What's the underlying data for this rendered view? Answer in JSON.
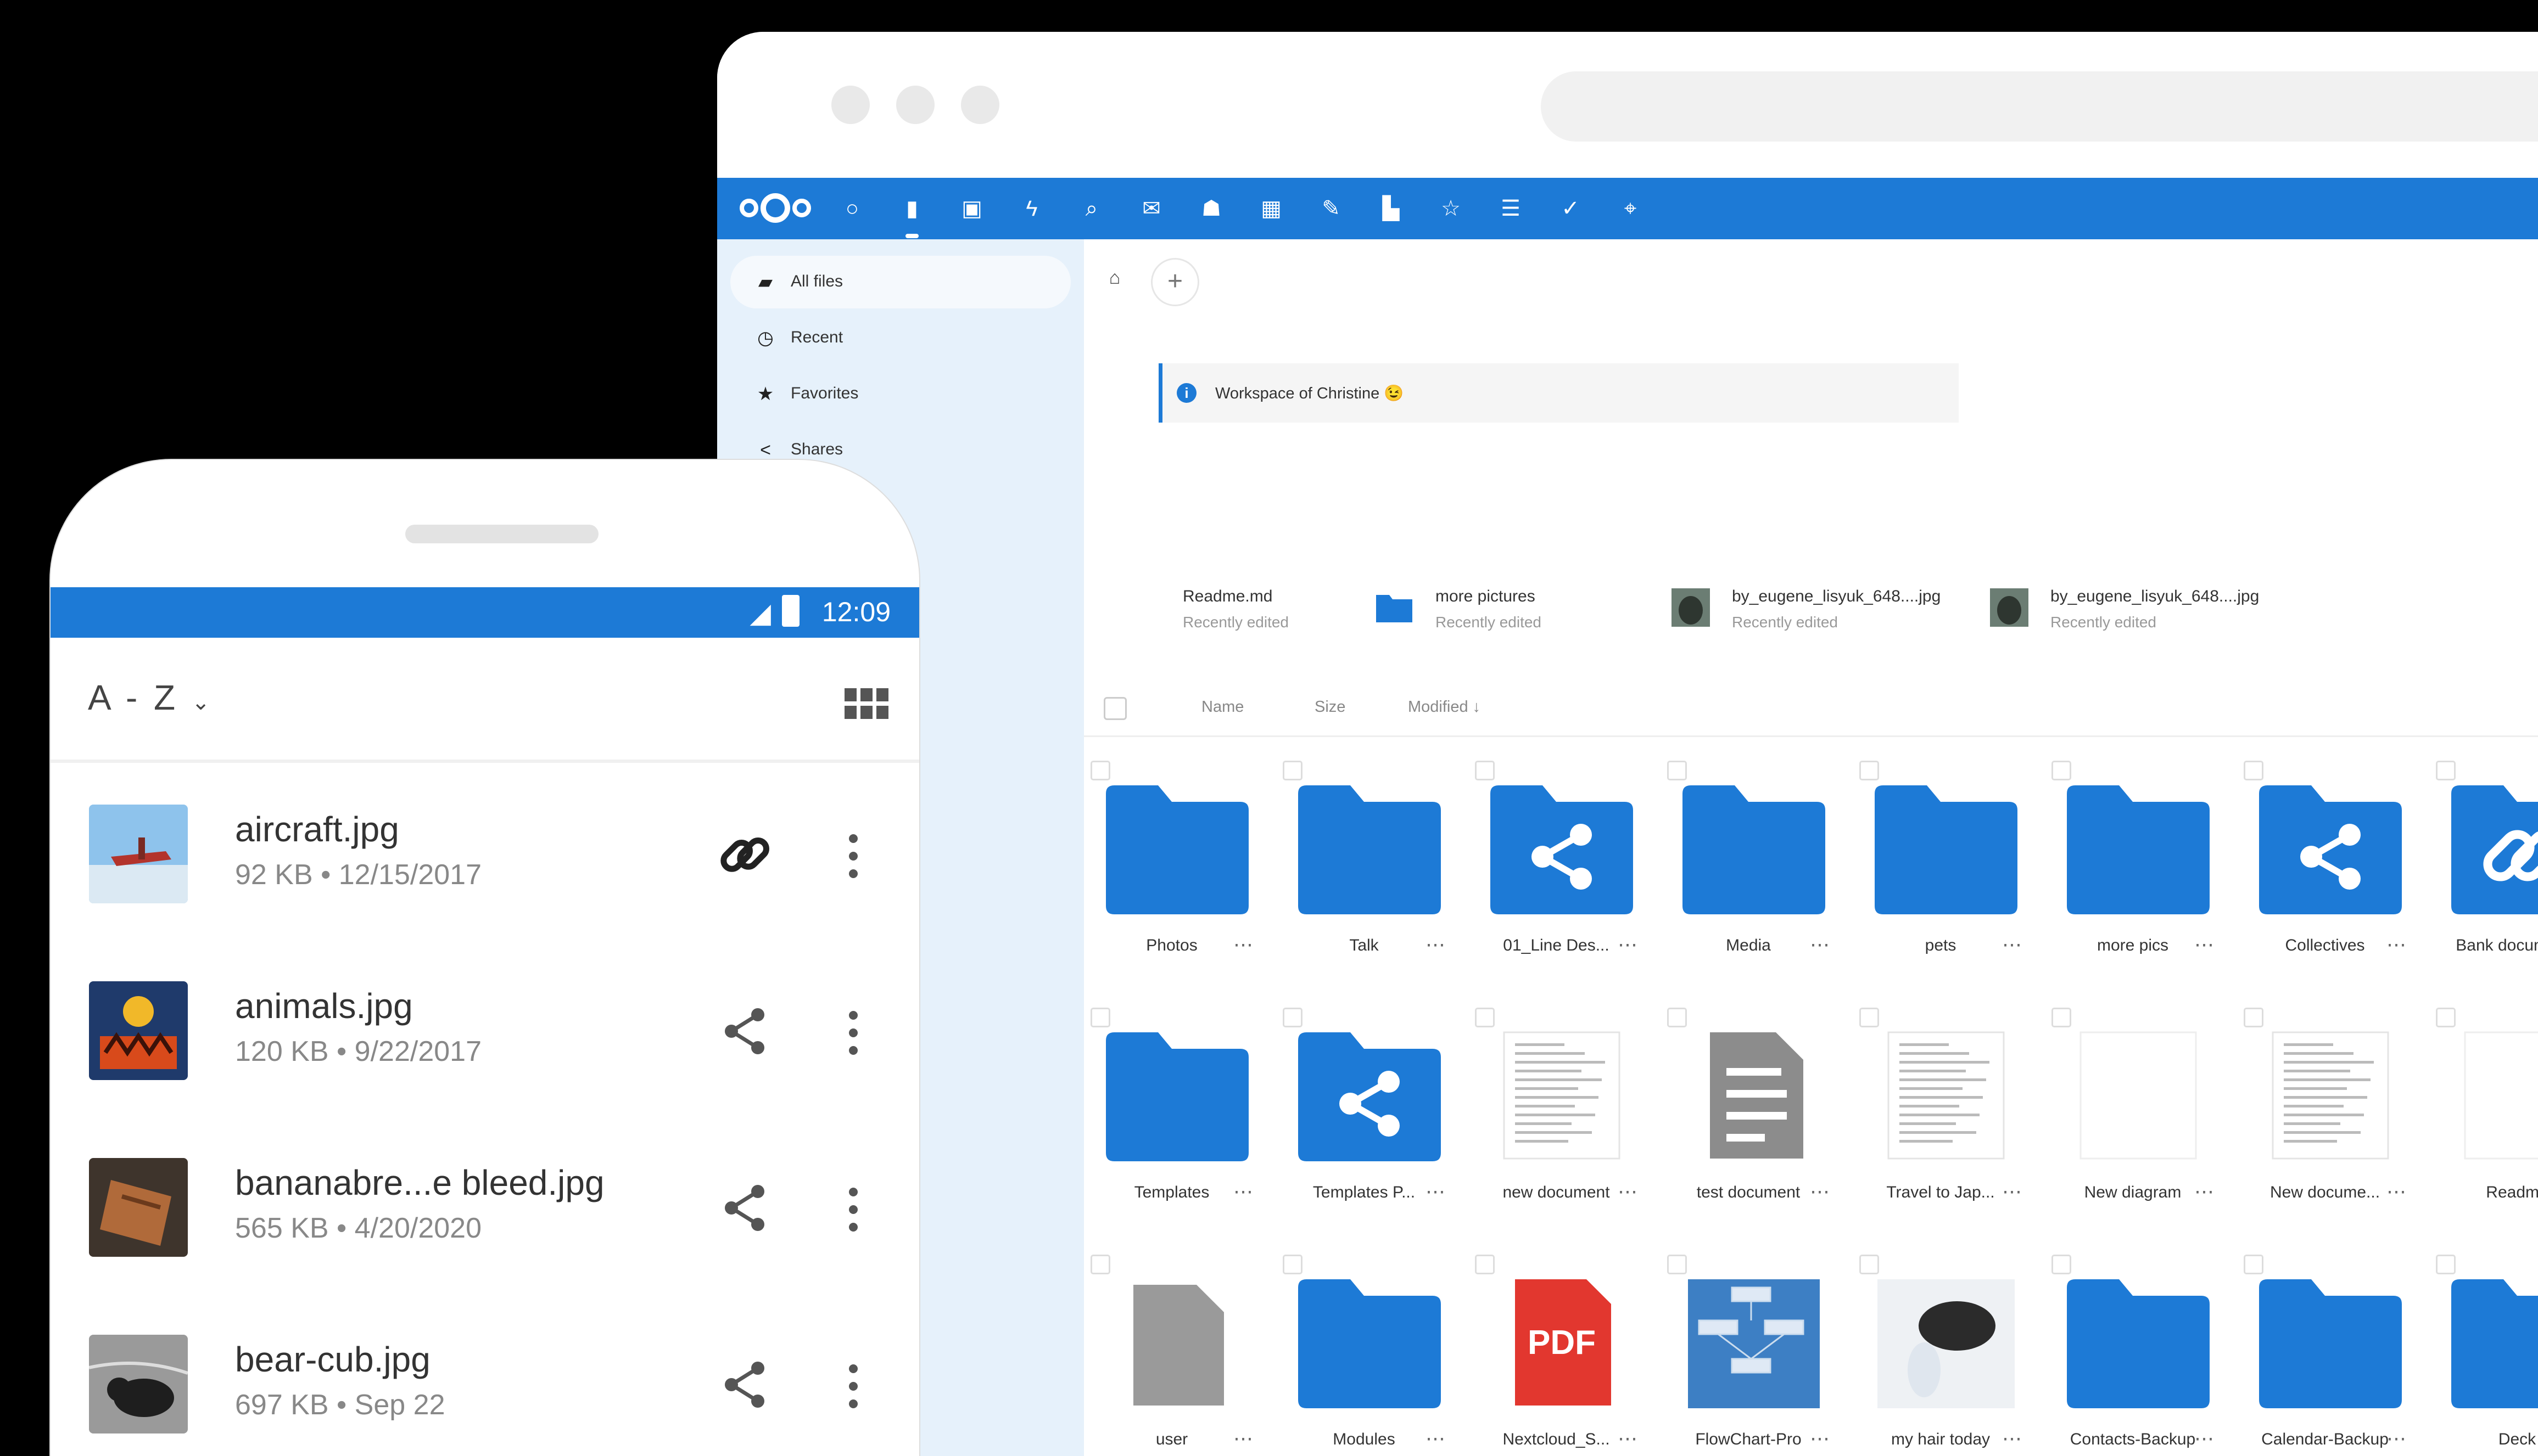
{
  "colors": {
    "brand": "#1d7ad6",
    "folder": "#1d7ad6",
    "sidebar_bg": "#e6f1fb"
  },
  "desktop": {
    "app_icons": [
      "dashboard-icon",
      "files-icon",
      "photos-icon",
      "activity-icon",
      "search-icon",
      "mail-icon",
      "contacts-icon",
      "calendar-icon",
      "notes-icon",
      "deck-icon",
      "bookmarks-icon",
      "tasks-icon",
      "checks-icon",
      "maps-icon"
    ],
    "sidebar": {
      "items": [
        {
          "label": "All files",
          "icon": "folder-icon",
          "selected": true
        },
        {
          "label": "Recent",
          "icon": "clock-icon",
          "selected": false
        },
        {
          "label": "Favorites",
          "icon": "star-icon",
          "selected": false
        },
        {
          "label": "Shares",
          "icon": "share-icon",
          "selected": false
        }
      ]
    },
    "breadcrumb": {
      "home_icon": "home-icon",
      "add_icon": "plus-icon"
    },
    "description": "Workspace of Christine 😉",
    "recent": [
      {
        "name": "Readme.md",
        "sub": "Recently edited",
        "kind": "doc"
      },
      {
        "name": "more pictures",
        "sub": "Recently edited",
        "kind": "folder"
      },
      {
        "name": "by_eugene_lisyuk_648....jpg",
        "sub": "Recently edited",
        "kind": "photo"
      },
      {
        "name": "by_eugene_lisyuk_648....jpg",
        "sub": "Recently edited",
        "kind": "photo"
      }
    ],
    "header": {
      "name": "Name",
      "size": "Size",
      "modified": "Modified ↓"
    },
    "grid": [
      [
        {
          "name": "Photos",
          "kind": "folder"
        },
        {
          "name": "Talk",
          "kind": "folder"
        },
        {
          "name": "01_Line Des...",
          "kind": "shared"
        },
        {
          "name": "Media",
          "kind": "folder"
        },
        {
          "name": "pets",
          "kind": "folder"
        },
        {
          "name": "more pics",
          "kind": "folder"
        },
        {
          "name": "Collectives",
          "kind": "shared"
        },
        {
          "name": "Bank documents",
          "kind": "link"
        }
      ],
      [
        {
          "name": "Templates",
          "kind": "folder"
        },
        {
          "name": "Templates P...",
          "kind": "shared"
        },
        {
          "name": "new document",
          "kind": "page"
        },
        {
          "name": "test document",
          "kind": "textdoc"
        },
        {
          "name": "Travel to Jap...",
          "kind": "page"
        },
        {
          "name": "New diagram",
          "kind": "blank"
        },
        {
          "name": "New docume...",
          "kind": "page"
        },
        {
          "name": "Readme",
          "kind": "blank"
        }
      ],
      [
        {
          "name": "user",
          "kind": "file"
        },
        {
          "name": "Modules",
          "kind": "folder"
        },
        {
          "name": "Nextcloud_S...",
          "kind": "pdf"
        },
        {
          "name": "FlowChart-Pro",
          "kind": "diagram"
        },
        {
          "name": "my hair today",
          "kind": "photo"
        },
        {
          "name": "Contacts-Backup",
          "kind": "folder"
        },
        {
          "name": "Calendar-Backup",
          "kind": "folder"
        },
        {
          "name": "Deck",
          "kind": "folder"
        }
      ]
    ],
    "pdf_label": "PDF"
  },
  "phone": {
    "time": "12:09",
    "sort_label": "A - Z",
    "files": [
      {
        "name": "aircraft.jpg",
        "meta": "92 KB • 12/15/2017",
        "action": "link-icon"
      },
      {
        "name": "animals.jpg",
        "meta": "120 KB • 9/22/2017",
        "action": "share-icon"
      },
      {
        "name": "bananabre...e bleed.jpg",
        "meta": "565 KB • 4/20/2020",
        "action": "share-icon"
      },
      {
        "name": "bear-cub.jpg",
        "meta": "697 KB • Sep 22",
        "action": "share-icon"
      }
    ]
  }
}
